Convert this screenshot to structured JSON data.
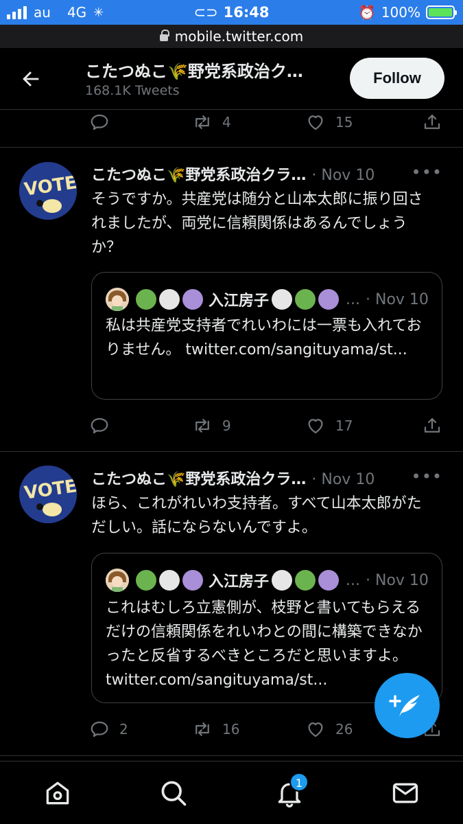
{
  "status_bar": {
    "carrier": "au",
    "network": "4G",
    "time": "16:48",
    "battery": "100%",
    "battery_level": 1.0
  },
  "url_bar": {
    "url": "mobile.twitter.com"
  },
  "header": {
    "title": "こたつぬこ🌾野党系政治ク…",
    "tweet_count": "168.1K Tweets",
    "follow_label": "Follow"
  },
  "top_actions": {
    "retweets": "4",
    "likes": "15"
  },
  "tweets": [
    {
      "name": "こたつぬこ🌾野党系政治クラ…",
      "date": "· Nov 10",
      "text": "そうですか。共産党は随分と山本太郎に振り回されましたが、両党に信頼関係はあるんでしょうか？",
      "quote": {
        "name": "入江房子",
        "ellipsis": "...",
        "date": "· Nov 10",
        "text": "私は共産党支持者でれいわには一票も入れておりません。 twitter.com/sangituyama/st..."
      },
      "replies": "",
      "retweets": "9",
      "likes": "17"
    },
    {
      "name": "こたつぬこ🌾野党系政治クラ…",
      "date": "· Nov 10",
      "text": "ほら、これがれいわ支持者。すべて山本太郎がただしい。話にならないんですよ。",
      "quote": {
        "name": "入江房子",
        "ellipsis": "...",
        "date": "· Nov 10",
        "text": "これはむしろ立憲側が、枝野と書いてもらえるだけの信頼関係をれいわとの間に構築できなかったと反省するべきところだと思いますよ。 twitter.com/sangituyama/st..."
      },
      "replies": "2",
      "retweets": "16",
      "likes": "26"
    }
  ],
  "colors": {
    "status_bar": "#2b7de9",
    "accent": "#1d9bf0",
    "dot_green": "#6bb34f",
    "dot_white": "#e6e6e6",
    "dot_purple": "#a98ed8"
  },
  "notifications_badge": "1"
}
